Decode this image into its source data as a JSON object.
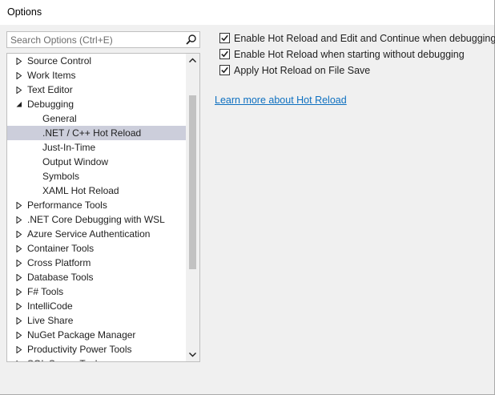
{
  "window": {
    "title": "Options"
  },
  "search": {
    "placeholder": "Search Options (Ctrl+E)",
    "value": ""
  },
  "tree": {
    "items": [
      {
        "label": "Source Control",
        "level": 0,
        "expander": "collapsed"
      },
      {
        "label": "Work Items",
        "level": 0,
        "expander": "collapsed"
      },
      {
        "label": "Text Editor",
        "level": 0,
        "expander": "collapsed"
      },
      {
        "label": "Debugging",
        "level": 0,
        "expander": "expanded"
      },
      {
        "label": "General",
        "level": 1,
        "expander": "none"
      },
      {
        "label": ".NET / C++ Hot Reload",
        "level": 1,
        "expander": "none",
        "selected": true
      },
      {
        "label": "Just-In-Time",
        "level": 1,
        "expander": "none"
      },
      {
        "label": "Output Window",
        "level": 1,
        "expander": "none"
      },
      {
        "label": "Symbols",
        "level": 1,
        "expander": "none"
      },
      {
        "label": "XAML Hot Reload",
        "level": 1,
        "expander": "none"
      },
      {
        "label": "Performance Tools",
        "level": 0,
        "expander": "collapsed"
      },
      {
        "label": ".NET Core Debugging with WSL",
        "level": 0,
        "expander": "collapsed"
      },
      {
        "label": "Azure Service Authentication",
        "level": 0,
        "expander": "collapsed"
      },
      {
        "label": "Container Tools",
        "level": 0,
        "expander": "collapsed"
      },
      {
        "label": "Cross Platform",
        "level": 0,
        "expander": "collapsed"
      },
      {
        "label": "Database Tools",
        "level": 0,
        "expander": "collapsed"
      },
      {
        "label": "F# Tools",
        "level": 0,
        "expander": "collapsed"
      },
      {
        "label": "IntelliCode",
        "level": 0,
        "expander": "collapsed"
      },
      {
        "label": "Live Share",
        "level": 0,
        "expander": "collapsed"
      },
      {
        "label": "NuGet Package Manager",
        "level": 0,
        "expander": "collapsed"
      },
      {
        "label": "Productivity Power Tools",
        "level": 0,
        "expander": "collapsed"
      },
      {
        "label": "SQL Server Tools",
        "level": 0,
        "expander": "collapsed"
      }
    ],
    "scroll": {
      "thumb_start": 0.1,
      "thumb_end": 0.72
    }
  },
  "options": [
    {
      "label": "Enable Hot Reload and Edit and Continue when debugging",
      "checked": true
    },
    {
      "label": "Enable Hot Reload when starting without debugging",
      "checked": true
    },
    {
      "label": "Apply Hot Reload on File Save",
      "checked": true
    }
  ],
  "link": {
    "label": "Learn more about Hot Reload"
  },
  "colors": {
    "selection": "#cccedb",
    "link": "#0e70c0",
    "scroll_thumb": "#c2c2c2"
  }
}
